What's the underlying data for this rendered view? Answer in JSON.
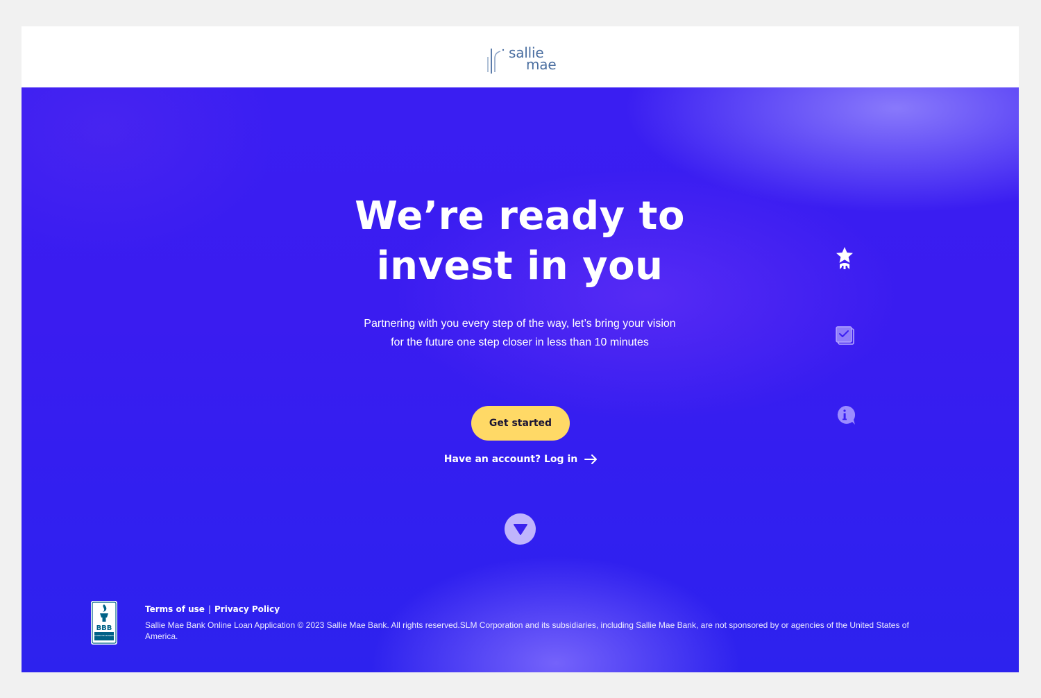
{
  "brand": {
    "logo_line1": "sallie",
    "logo_line2": "mae"
  },
  "hero": {
    "headline_line1": "We’re ready to",
    "headline_line2": "invest in you",
    "subtext_line1": "Partnering with you every step of the way, let’s bring your vision",
    "subtext_line2": "for the future one step closer in less than 10 minutes",
    "cta_label": "Get started",
    "login_label": "Have an account? Log in"
  },
  "side_icons": [
    "star-award-icon",
    "checklist-icon",
    "info-chat-icon"
  ],
  "footer": {
    "terms_label": "Terms of use",
    "separator": "|",
    "privacy_label": "Privacy Policy",
    "legal": "Sallie Mae Bank Online Loan Application © 2023 Sallie Mae Bank. All rights reserved.SLM Corporation and its subsidiaries, including Sallie Mae Bank, are not sponsored by or agencies of the United States of America.",
    "bbb_label": "BBB",
    "bbb_sub": "ACCREDITED BUSINESS"
  },
  "colors": {
    "hero_background": "#3a1ef2",
    "cta_background": "#ffd966",
    "logo_color": "#4a6ea0",
    "bbb_blue": "#006187"
  }
}
